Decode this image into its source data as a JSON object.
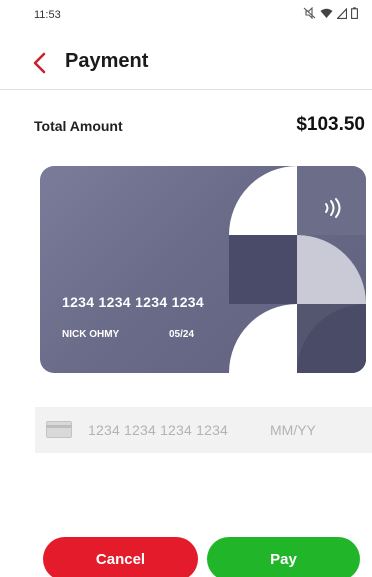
{
  "status_bar": {
    "time": "11:53",
    "icons": [
      "mute-icon",
      "wifi-icon",
      "signal-icon",
      "battery-icon"
    ]
  },
  "header": {
    "back_icon": "chevron-left-icon",
    "title": "Payment"
  },
  "total": {
    "label": "Total Amount",
    "value": "$103.50"
  },
  "card": {
    "number": "1234 1234 1234 1234",
    "holder": "NICK OHMY",
    "expiry": "05/24",
    "contactless_icon": "contactless-icon"
  },
  "card_input": {
    "card_icon": "credit-card-icon",
    "number_placeholder": "1234 1234 1234 1234",
    "expiry_placeholder": "MM/YY"
  },
  "buttons": {
    "cancel_label": "Cancel",
    "pay_label": "Pay"
  },
  "colors": {
    "accent_back": "#c8242f",
    "cancel": "#e31b2a",
    "pay": "#21b52a",
    "card": "#6b6d8a"
  }
}
